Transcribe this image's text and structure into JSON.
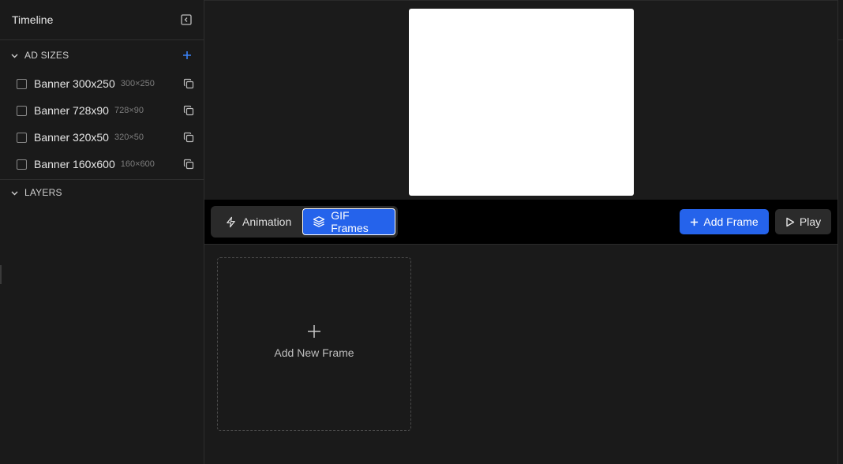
{
  "sidebar": {
    "title": "Timeline",
    "ad_sizes_section": {
      "label": "AD SIZES"
    },
    "sizes": [
      {
        "name": "Banner 300x250",
        "dim": "300×250"
      },
      {
        "name": "Banner 728x90",
        "dim": "728×90"
      },
      {
        "name": "Banner 320x50",
        "dim": "320×50"
      },
      {
        "name": "Banner 160x600",
        "dim": "160×600"
      }
    ],
    "layers_section": {
      "label": "LAYERS"
    }
  },
  "toolbar": {
    "tabs": [
      {
        "label": "Animation",
        "icon": "lightning-icon",
        "active": false
      },
      {
        "label": "GIF Frames",
        "icon": "layers-icon",
        "active": true
      }
    ],
    "add_frame_label": "Add Frame",
    "play_label": "Play"
  },
  "frames": {
    "add_new_label": "Add New Frame"
  },
  "colors": {
    "accent": "#2563eb",
    "background": "#1a1a1a",
    "toolbar_bg": "#000000",
    "canvas_frame": "#ffffff"
  }
}
